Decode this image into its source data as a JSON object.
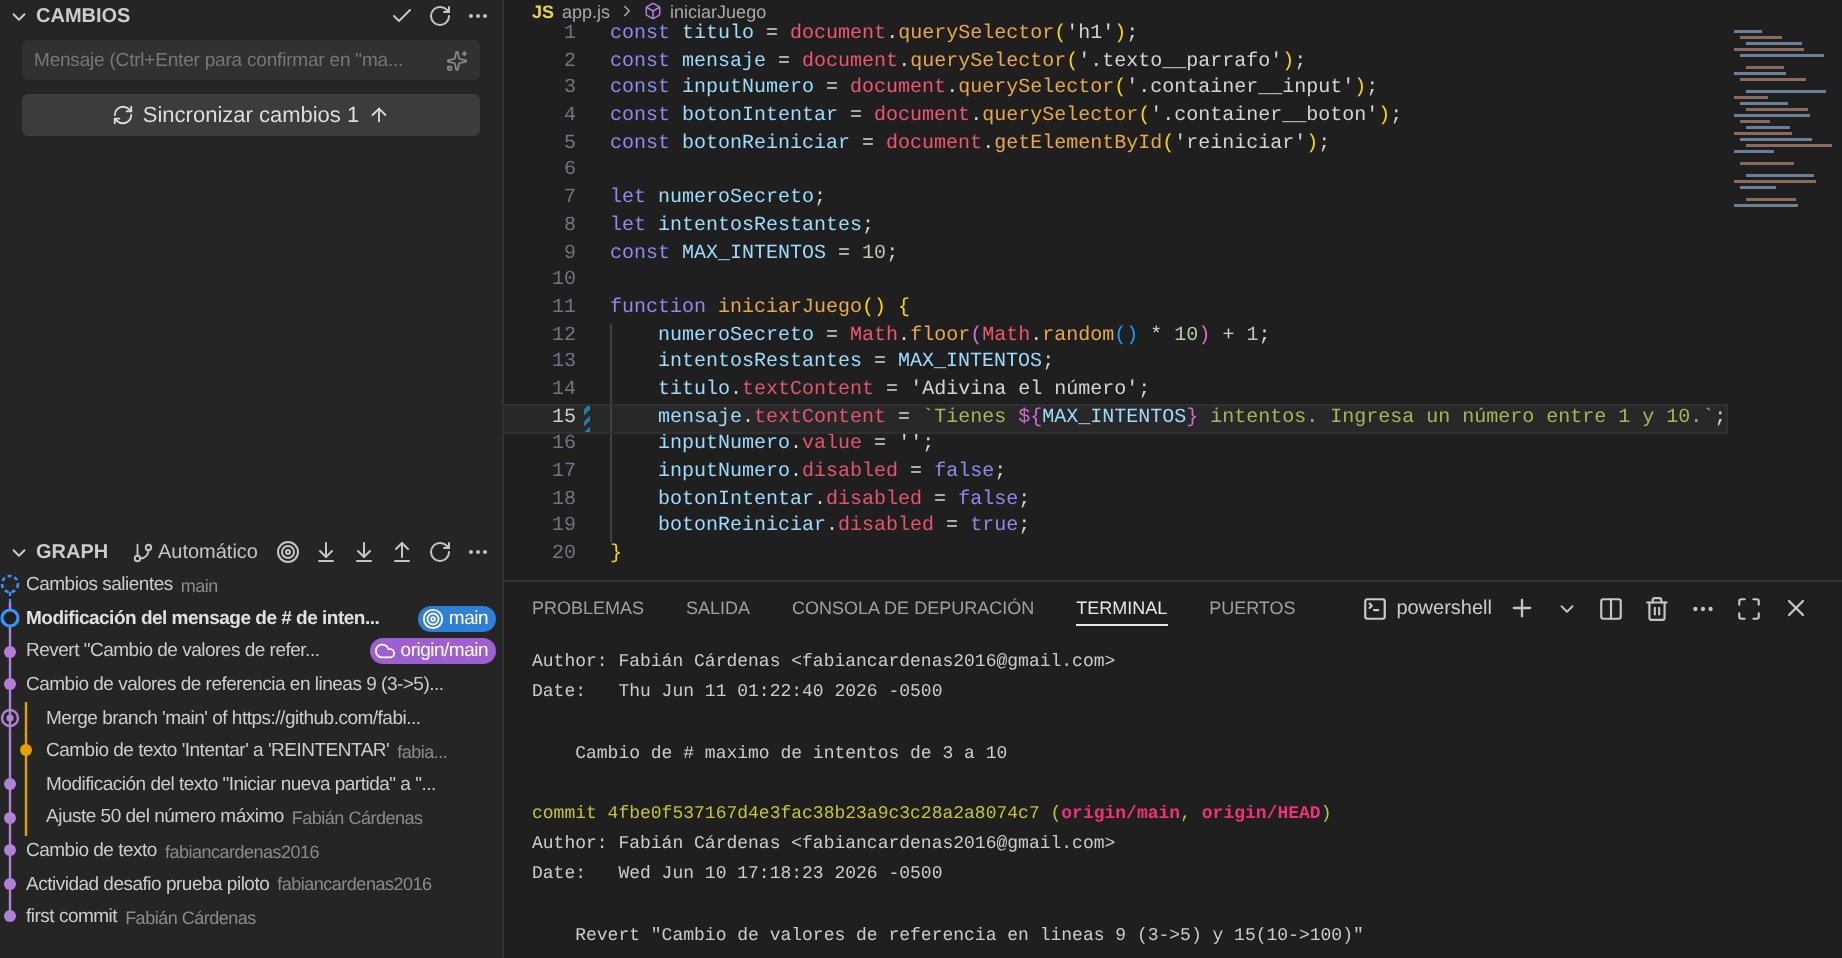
{
  "sidebar": {
    "changes_header": {
      "title": "CAMBIOS",
      "expanded": true
    },
    "message_field": {
      "placeholder": "Mensaje (Ctrl+Enter para confirmar en \"ma..."
    },
    "sync_button": {
      "label": "Sincronizar cambios 1"
    },
    "graph": {
      "title": "GRAPH",
      "expanded": true,
      "mode_button": "Automático",
      "rows": [
        {
          "kind": "outgoing",
          "message": "Cambios salientes",
          "detail": "main",
          "in_merge": false
        },
        {
          "kind": "head",
          "message": "Modificación del mensage de #  de inten...",
          "in_merge": false,
          "badge": {
            "label": "main",
            "kind": "local"
          }
        },
        {
          "kind": "commit",
          "message": "Revert \"Cambio de valores de refer...",
          "in_merge": false,
          "badge": {
            "label": "origin/main",
            "kind": "remote"
          }
        },
        {
          "kind": "commit",
          "message": "Cambio de valores de referencia en lineas 9 (3->5)...",
          "in_merge": false
        },
        {
          "kind": "merge",
          "message": "Merge branch 'main' of https://github.com/fabi...",
          "in_merge": true
        },
        {
          "kind": "branch",
          "message": "Cambio de texto 'Intentar' a 'REINTENTAR'",
          "detail": "fabia...",
          "in_merge": true
        },
        {
          "kind": "commit",
          "message": "Modificación del texto \"Iniciar nueva partida\" a \"...",
          "in_merge": true
        },
        {
          "kind": "commit",
          "message": "Ajuste 50 del número máximo",
          "detail": "Fabián Cárdenas",
          "in_merge": true
        },
        {
          "kind": "commit",
          "message": "Cambio de texto",
          "detail": "fabiancardenas2016",
          "in_merge": false
        },
        {
          "kind": "commit",
          "message": "Actividad desafio prueba piloto",
          "detail": "fabiancardenas2016",
          "in_merge": false
        },
        {
          "kind": "commit",
          "message": "first commit",
          "detail": "Fabián Cárdenas",
          "in_merge": false
        }
      ]
    }
  },
  "editor": {
    "file_badge": "JS",
    "breadcrumb": [
      "app.js",
      "iniciarJuego"
    ],
    "lines": [
      {
        "number": "1",
        "tokens": [
          {
            "text": "const ",
            "kind": "keyword"
          },
          {
            "text": "titulo",
            "kind": "variable"
          },
          {
            "text": " = ",
            "kind": "plain"
          },
          {
            "text": "document",
            "kind": "object"
          },
          {
            "text": ".",
            "kind": "plain"
          },
          {
            "text": "querySelector",
            "kind": "method"
          },
          {
            "text": "(",
            "kind": "bracket"
          },
          {
            "text": "'h1'",
            "kind": "string"
          },
          {
            "text": ")",
            "kind": "bracket"
          },
          {
            "text": ";",
            "kind": "plain"
          }
        ]
      },
      {
        "number": "2",
        "tokens": [
          {
            "text": "const ",
            "kind": "keyword"
          },
          {
            "text": "mensaje",
            "kind": "variable"
          },
          {
            "text": " = ",
            "kind": "plain"
          },
          {
            "text": "document",
            "kind": "object"
          },
          {
            "text": ".",
            "kind": "plain"
          },
          {
            "text": "querySelector",
            "kind": "method"
          },
          {
            "text": "(",
            "kind": "bracket"
          },
          {
            "text": "'.texto__parrafo'",
            "kind": "string"
          },
          {
            "text": ")",
            "kind": "bracket"
          },
          {
            "text": ";",
            "kind": "plain"
          }
        ]
      },
      {
        "number": "3",
        "tokens": [
          {
            "text": "const ",
            "kind": "keyword"
          },
          {
            "text": "inputNumero",
            "kind": "variable"
          },
          {
            "text": " = ",
            "kind": "plain"
          },
          {
            "text": "document",
            "kind": "object"
          },
          {
            "text": ".",
            "kind": "plain"
          },
          {
            "text": "querySelector",
            "kind": "method"
          },
          {
            "text": "(",
            "kind": "bracket"
          },
          {
            "text": "'.container__input'",
            "kind": "string"
          },
          {
            "text": ")",
            "kind": "bracket"
          },
          {
            "text": ";",
            "kind": "plain"
          }
        ]
      },
      {
        "number": "4",
        "tokens": [
          {
            "text": "const ",
            "kind": "keyword"
          },
          {
            "text": "botonIntentar",
            "kind": "variable"
          },
          {
            "text": " = ",
            "kind": "plain"
          },
          {
            "text": "document",
            "kind": "object"
          },
          {
            "text": ".",
            "kind": "plain"
          },
          {
            "text": "querySelector",
            "kind": "method"
          },
          {
            "text": "(",
            "kind": "bracket"
          },
          {
            "text": "'.container__boton'",
            "kind": "string"
          },
          {
            "text": ")",
            "kind": "bracket"
          },
          {
            "text": ";",
            "kind": "plain"
          }
        ]
      },
      {
        "number": "5",
        "tokens": [
          {
            "text": "const ",
            "kind": "keyword"
          },
          {
            "text": "botonReiniciar",
            "kind": "variable"
          },
          {
            "text": " = ",
            "kind": "plain"
          },
          {
            "text": "document",
            "kind": "object"
          },
          {
            "text": ".",
            "kind": "plain"
          },
          {
            "text": "getElementById",
            "kind": "method"
          },
          {
            "text": "(",
            "kind": "bracket"
          },
          {
            "text": "'reiniciar'",
            "kind": "string"
          },
          {
            "text": ")",
            "kind": "bracket"
          },
          {
            "text": ";",
            "kind": "plain"
          }
        ]
      },
      {
        "number": "6"
      },
      {
        "number": "7",
        "tokens": [
          {
            "text": "let ",
            "kind": "keyword"
          },
          {
            "text": "numeroSecreto",
            "kind": "variable"
          },
          {
            "text": ";",
            "kind": "plain"
          }
        ]
      },
      {
        "number": "8",
        "tokens": [
          {
            "text": "let ",
            "kind": "keyword"
          },
          {
            "text": "intentosRestantes",
            "kind": "variable"
          },
          {
            "text": ";",
            "kind": "plain"
          }
        ]
      },
      {
        "number": "9",
        "tokens": [
          {
            "text": "const ",
            "kind": "keyword"
          },
          {
            "text": "MAX_INTENTOS",
            "kind": "constant"
          },
          {
            "text": " = ",
            "kind": "plain"
          },
          {
            "text": "10",
            "kind": "number"
          },
          {
            "text": ";",
            "kind": "plain"
          }
        ]
      },
      {
        "number": "10"
      },
      {
        "number": "11",
        "tokens": [
          {
            "text": "function ",
            "kind": "keyword"
          },
          {
            "text": "iniciarJuego",
            "kind": "function"
          },
          {
            "text": "() ",
            "kind": "bracket"
          },
          {
            "text": "{",
            "kind": "bracket"
          }
        ]
      },
      {
        "number": "12",
        "indent": true,
        "tokens": [
          {
            "text": "numeroSecreto",
            "kind": "variable"
          },
          {
            "text": " = ",
            "kind": "plain"
          },
          {
            "text": "Math",
            "kind": "object"
          },
          {
            "text": ".",
            "kind": "plain"
          },
          {
            "text": "floor",
            "kind": "method"
          },
          {
            "text": "(",
            "kind": "bracket2"
          },
          {
            "text": "Math",
            "kind": "object"
          },
          {
            "text": ".",
            "kind": "plain"
          },
          {
            "text": "random",
            "kind": "method"
          },
          {
            "text": "()",
            "kind": "bracket3"
          },
          {
            "text": " * ",
            "kind": "plain"
          },
          {
            "text": "10",
            "kind": "number"
          },
          {
            "text": ")",
            "kind": "bracket2"
          },
          {
            "text": " + ",
            "kind": "plain"
          },
          {
            "text": "1",
            "kind": "number"
          },
          {
            "text": ";",
            "kind": "plain"
          }
        ]
      },
      {
        "number": "13",
        "indent": true,
        "tokens": [
          {
            "text": "intentosRestantes",
            "kind": "variable"
          },
          {
            "text": " = ",
            "kind": "plain"
          },
          {
            "text": "MAX_INTENTOS",
            "kind": "constant"
          },
          {
            "text": ";",
            "kind": "plain"
          }
        ]
      },
      {
        "number": "14",
        "indent": true,
        "tokens": [
          {
            "text": "titulo",
            "kind": "variable"
          },
          {
            "text": ".",
            "kind": "plain"
          },
          {
            "text": "textContent",
            "kind": "property"
          },
          {
            "text": " = ",
            "kind": "plain"
          },
          {
            "text": "'Adivina el número'",
            "kind": "string"
          },
          {
            "text": ";",
            "kind": "plain"
          }
        ]
      },
      {
        "number": "15",
        "indent": true,
        "current": true,
        "modified": true,
        "tokens": [
          {
            "text": "mensaje",
            "kind": "variable"
          },
          {
            "text": ".",
            "kind": "plain"
          },
          {
            "text": "textContent",
            "kind": "property"
          },
          {
            "text": " = ",
            "kind": "plain"
          },
          {
            "text": "`Tienes ",
            "kind": "template"
          },
          {
            "text": "${",
            "kind": "interp"
          },
          {
            "text": "MAX_INTENTOS",
            "kind": "constant"
          },
          {
            "text": "}",
            "kind": "interp"
          },
          {
            "text": " intentos. Ingresa un número entre 1 y 10.`",
            "kind": "template"
          },
          {
            "text": ";",
            "kind": "plain"
          }
        ]
      },
      {
        "number": "16",
        "indent": true,
        "tokens": [
          {
            "text": "inputNumero",
            "kind": "variable"
          },
          {
            "text": ".",
            "kind": "plain"
          },
          {
            "text": "value",
            "kind": "property"
          },
          {
            "text": " = ",
            "kind": "plain"
          },
          {
            "text": "''",
            "kind": "string"
          },
          {
            "text": ";",
            "kind": "plain"
          }
        ]
      },
      {
        "number": "17",
        "indent": true,
        "tokens": [
          {
            "text": "inputNumero",
            "kind": "variable"
          },
          {
            "text": ".",
            "kind": "plain"
          },
          {
            "text": "disabled",
            "kind": "property"
          },
          {
            "text": " = ",
            "kind": "plain"
          },
          {
            "text": "false",
            "kind": "keyword"
          },
          {
            "text": ";",
            "kind": "plain"
          }
        ]
      },
      {
        "number": "18",
        "indent": true,
        "tokens": [
          {
            "text": "botonIntentar",
            "kind": "variable"
          },
          {
            "text": ".",
            "kind": "plain"
          },
          {
            "text": "disabled",
            "kind": "property"
          },
          {
            "text": " = ",
            "kind": "plain"
          },
          {
            "text": "false",
            "kind": "keyword"
          },
          {
            "text": ";",
            "kind": "plain"
          }
        ]
      },
      {
        "number": "19",
        "indent": true,
        "tokens": [
          {
            "text": "botonReiniciar",
            "kind": "variable"
          },
          {
            "text": ".",
            "kind": "plain"
          },
          {
            "text": "disabled",
            "kind": "property"
          },
          {
            "text": " = ",
            "kind": "plain"
          },
          {
            "text": "true",
            "kind": "keyword"
          },
          {
            "text": ";",
            "kind": "plain"
          }
        ]
      },
      {
        "number": "20",
        "tokens": [
          {
            "text": "}",
            "kind": "bracket"
          }
        ]
      }
    ]
  },
  "panel": {
    "tabs": [
      {
        "label": "PROBLEMAS",
        "selected": false
      },
      {
        "label": "SALIDA",
        "selected": false
      },
      {
        "label": "CONSOLA DE DEPURACIÓN",
        "selected": false
      },
      {
        "label": "TERMINAL",
        "selected": true
      },
      {
        "label": "PUERTOS",
        "selected": false
      }
    ],
    "shell": "powershell",
    "terminal_lines": [
      {
        "kind": "text",
        "segments": [
          {
            "text": "Author: Fabián Cárdenas <fabiancardenas2016@gmail.com>",
            "kind": "plain"
          }
        ]
      },
      {
        "kind": "text",
        "segments": [
          {
            "text": "Date:   Thu Jun 11 01:22:40 2026 -0500",
            "kind": "plain"
          }
        ]
      },
      {
        "kind": "blank"
      },
      {
        "kind": "text",
        "segments": [
          {
            "text": "    Cambio de # maximo de intentos de 3 a 10",
            "kind": "plain"
          }
        ]
      },
      {
        "kind": "blank"
      },
      {
        "kind": "text",
        "segments": [
          {
            "text": "commit 4fbe0f537167d4e3fac38b23a9c3c28a2a8074c7 (",
            "kind": "commit"
          },
          {
            "text": "origin/main",
            "kind": "ref"
          },
          {
            "text": ", ",
            "kind": "commit"
          },
          {
            "text": "origin/HEAD",
            "kind": "ref"
          },
          {
            "text": ")",
            "kind": "commit"
          }
        ]
      },
      {
        "kind": "text",
        "segments": [
          {
            "text": "Author: Fabián Cárdenas <fabiancardenas2016@gmail.com>",
            "kind": "plain"
          }
        ]
      },
      {
        "kind": "text",
        "segments": [
          {
            "text": "Date:   Wed Jun 10 17:18:23 2026 -0500",
            "kind": "plain"
          }
        ]
      },
      {
        "kind": "blank"
      },
      {
        "kind": "text",
        "segments": [
          {
            "text": "    Revert \"Cambio de valores de referencia en lineas 9 (3->5) y 15(10->100)\"",
            "kind": "plain"
          }
        ]
      }
    ]
  }
}
